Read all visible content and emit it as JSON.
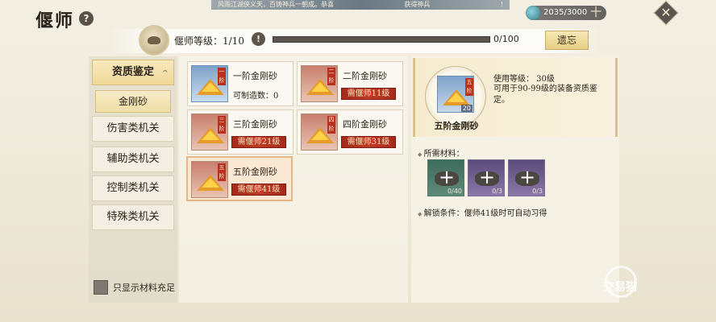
{
  "top_banner": {
    "left": "风雨江湖侠义天，百铸神兵一朝成。恭喜",
    "right": "获得神兵",
    "tail": "!"
  },
  "header": {
    "title": "偃师",
    "help_icon": "?"
  },
  "currency": {
    "value": "2035/3000",
    "plus": "十",
    "icon": "gem-icon"
  },
  "close_icon": "✕",
  "level": {
    "label": "偃师等级：1/10",
    "info_icon": "!",
    "progress_text": "0/100",
    "progress_fraction": 0.0,
    "heritage_button": "遗忘"
  },
  "categories": [
    {
      "label": "资质鉴定",
      "active": true
    },
    {
      "label": "伤害类机关"
    },
    {
      "label": "辅助类机关"
    },
    {
      "label": "控制类机关"
    },
    {
      "label": "特殊类机关"
    }
  ],
  "subcategory": {
    "label": "金刚砂"
  },
  "filter": {
    "label": "只显示材料充足"
  },
  "items": [
    {
      "name": "一阶金刚砂",
      "sub": "可制造数：0",
      "tag": "一阶",
      "color": "blue"
    },
    {
      "name": "二阶金刚砂",
      "req": "需偃师11级",
      "tag": "二阶",
      "color": "red"
    },
    {
      "name": "三阶金刚砂",
      "req": "需偃师21级",
      "tag": "三阶",
      "color": "red"
    },
    {
      "name": "四阶金刚砂",
      "req": "需偃师31级",
      "tag": "四阶",
      "color": "red"
    },
    {
      "name": "五阶金刚砂",
      "req": "需偃师41级",
      "tag": "五阶",
      "color": "red",
      "selected": true
    }
  ],
  "detail": {
    "name": "五阶金刚砂",
    "tag": "五阶",
    "count": "20",
    "use_level": "使用等级：   30级",
    "description": "可用于90-99级的装备资质鉴定。",
    "materials_title": "所需材料：",
    "materials": [
      {
        "count": "0/40",
        "color": "green"
      },
      {
        "count": "0/3",
        "color": "purple"
      },
      {
        "count": "0/3",
        "color": "purple"
      }
    ],
    "unlock": "解锁条件：偃师41级时可自动习得"
  },
  "watermark": "交易猫"
}
